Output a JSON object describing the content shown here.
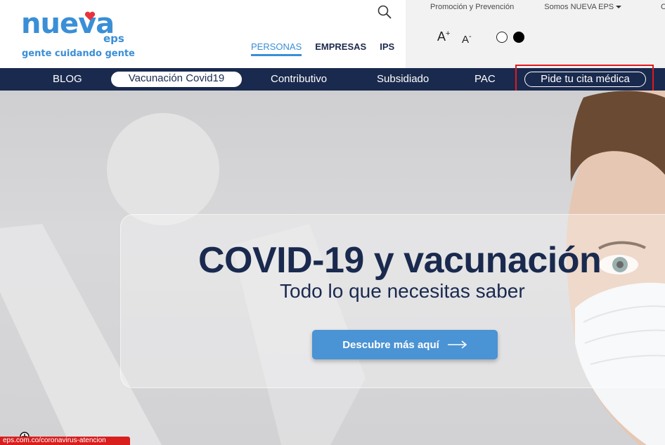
{
  "logo": {
    "text": "nueva",
    "sub": "eps",
    "tagline": "gente cuidando gente"
  },
  "segments": [
    "PERSONAS",
    "EMPRESAS",
    "IPS"
  ],
  "top_links": {
    "promo": "Promoción y Prevención",
    "somos": "Somos NUEVA EPS",
    "third": "C"
  },
  "accessibility": {
    "font_up": "A",
    "font_up_sup": "+",
    "font_down": "A",
    "font_down_sup": "-"
  },
  "nav": {
    "blog": "BLOG",
    "vacunacion": "Vacunación Covid19",
    "contributivo": "Contributivo",
    "subsidiado": "Subsidiado",
    "pac": "PAC",
    "cita": "Pide tu cita médica"
  },
  "hero": {
    "title": "COVID-19 y vacunación",
    "subtitle": "Todo lo que necesitas saber",
    "button": "Descubre más aquí"
  },
  "status_bar": {
    "url": "eps.com.co/coronavirus-atencion"
  },
  "colors": {
    "navy": "#1a2a4e",
    "brand_blue": "#3a8fd6",
    "button_blue": "#4a93d4",
    "highlight_red": "#e0191e"
  }
}
